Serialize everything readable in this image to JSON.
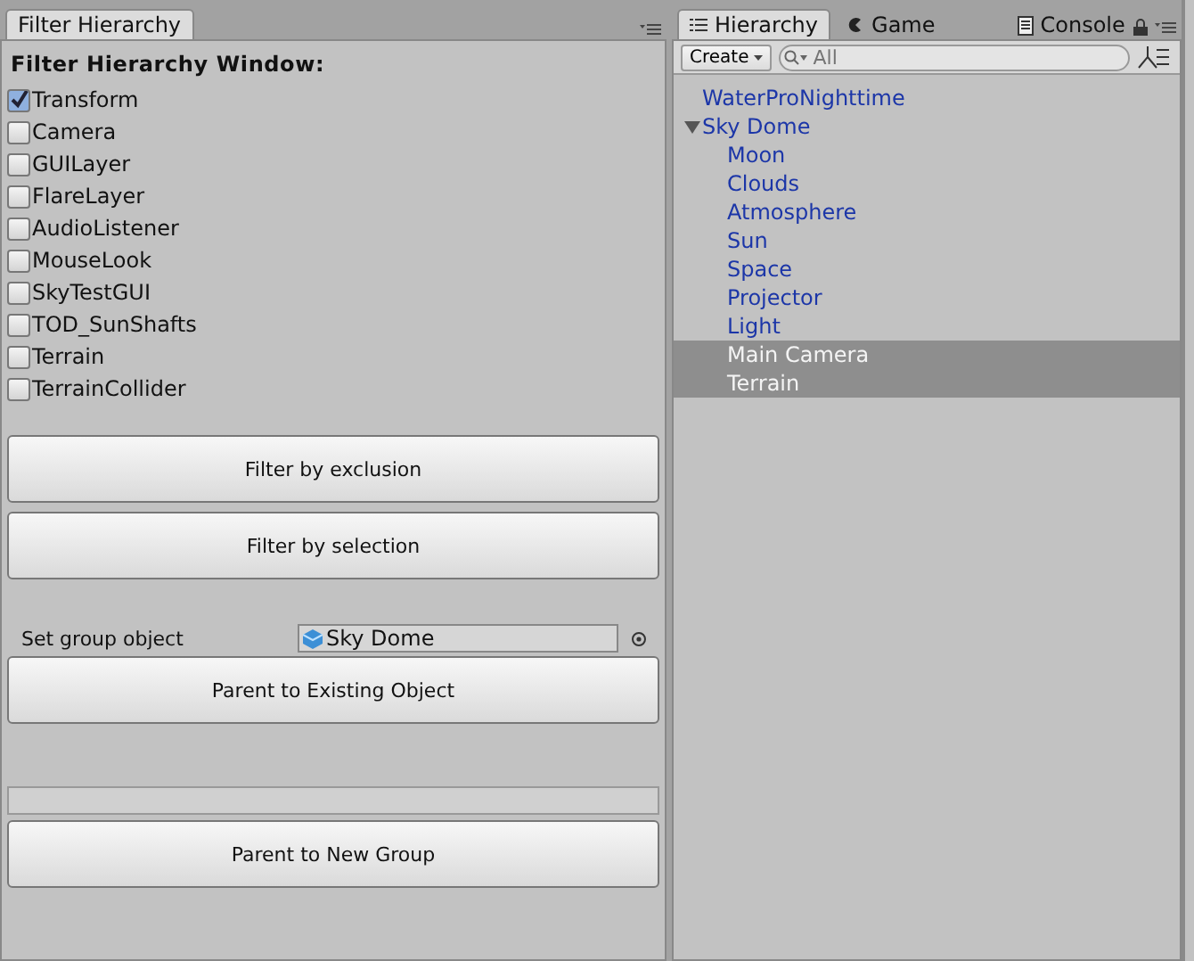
{
  "left_panel": {
    "tabs": [
      {
        "label": "Filter Hierarchy",
        "selected": true
      }
    ],
    "heading": "Filter Hierarchy Window:",
    "components": [
      {
        "label": "Transform",
        "checked": true
      },
      {
        "label": "Camera",
        "checked": false
      },
      {
        "label": "GUILayer",
        "checked": false
      },
      {
        "label": "FlareLayer",
        "checked": false
      },
      {
        "label": "AudioListener",
        "checked": false
      },
      {
        "label": "MouseLook",
        "checked": false
      },
      {
        "label": "SkyTestGUI",
        "checked": false
      },
      {
        "label": "TOD_SunShafts",
        "checked": false
      },
      {
        "label": "Terrain",
        "checked": false
      },
      {
        "label": "TerrainCollider",
        "checked": false
      }
    ],
    "filter_buttons": [
      "Filter by exclusion",
      "Filter by selection"
    ],
    "group_object": {
      "label": "Set group object",
      "value": "Sky Dome"
    },
    "parent_existing_button": "Parent to Existing Object",
    "parent_new_button": "Parent to New Group"
  },
  "right_panel": {
    "tabs": [
      {
        "label": "Hierarchy",
        "kind": "list",
        "selected": true
      },
      {
        "label": "Game",
        "kind": "game",
        "selected": false
      },
      {
        "label": "Console",
        "kind": "console",
        "selected": false
      }
    ],
    "create_button": "Create",
    "search": {
      "placeholder": "All"
    },
    "tree": [
      {
        "name": "WaterProNighttime",
        "selected": false
      },
      {
        "name": "Sky Dome",
        "selected": false,
        "expanded": true,
        "children": [
          {
            "name": "Moon",
            "selected": false
          },
          {
            "name": "Clouds",
            "selected": false
          },
          {
            "name": "Atmosphere",
            "selected": false
          },
          {
            "name": "Sun",
            "selected": false
          },
          {
            "name": "Space",
            "selected": false
          },
          {
            "name": "Projector",
            "selected": false
          },
          {
            "name": "Light",
            "selected": false
          },
          {
            "name": "Main Camera",
            "selected": true
          },
          {
            "name": "Terrain",
            "selected": true
          }
        ]
      }
    ]
  }
}
